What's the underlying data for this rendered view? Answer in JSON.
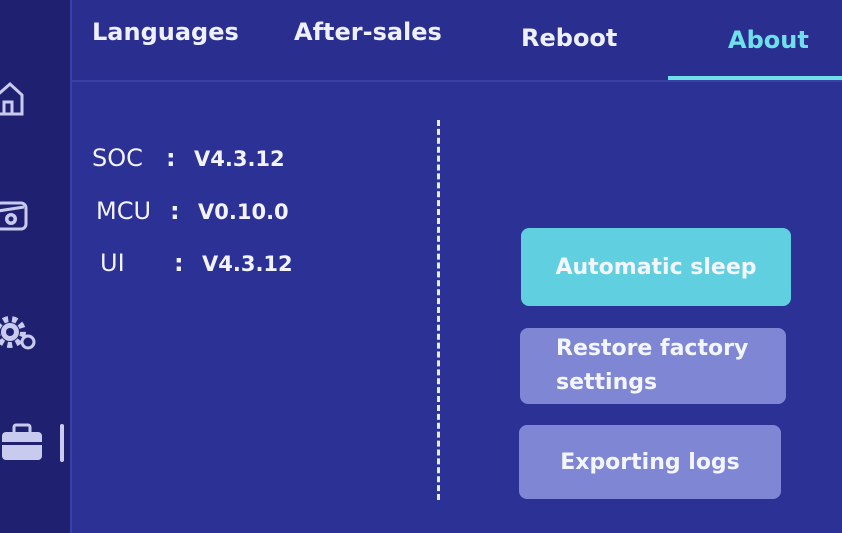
{
  "tabs": [
    {
      "label": "Languages",
      "active": false
    },
    {
      "label": "After-sales",
      "active": false
    },
    {
      "label": "Reboot",
      "active": false
    },
    {
      "label": "About",
      "active": true
    }
  ],
  "sidebar": {
    "items": [
      {
        "icon": "home-icon"
      },
      {
        "icon": "vehicle-icon"
      },
      {
        "icon": "gear-icon"
      },
      {
        "icon": "toolbox-icon",
        "selected": true
      }
    ]
  },
  "versions": [
    {
      "key": "SOC",
      "sep": ":",
      "value": "V4.3.12"
    },
    {
      "key": "MCU",
      "sep": ":",
      "value": "V0.10.0"
    },
    {
      "key": "UI",
      "sep": ":",
      "value": "V4.3.12"
    }
  ],
  "buttons": {
    "sleep": "Automatic sleep",
    "factory_line1": "Restore factory",
    "factory_line2": "settings",
    "export": "Exporting logs"
  },
  "colors": {
    "background": "#2c3195",
    "accent": "#6fe0ea",
    "button_primary": "#60cfe0",
    "button_secondary": "#7f86d4"
  }
}
